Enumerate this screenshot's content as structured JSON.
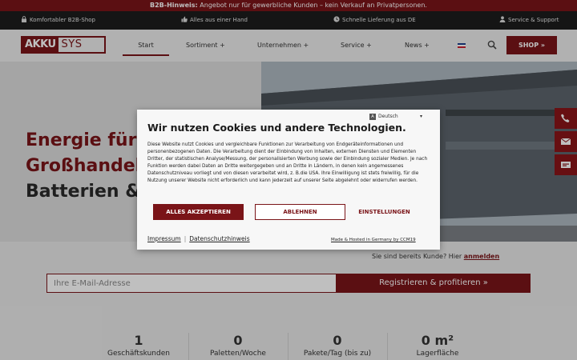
{
  "topbar": {
    "bold": "B2B-Hinweis:",
    "text": " Angebot nur für gewerbliche Kunden – kein Verkauf an Privatpersonen."
  },
  "infobar": {
    "items": [
      {
        "label": "Komfortabler B2B-Shop",
        "icon": "lock-icon"
      },
      {
        "label": "Alles aus einer Hand",
        "icon": "thumbs-up-icon"
      },
      {
        "label": "Schnelle Lieferung aus DE",
        "icon": "clock-icon"
      },
      {
        "label": "Service & Support",
        "icon": "user-icon"
      }
    ]
  },
  "logo": {
    "part1": "AKKU",
    "part2": "SYS"
  },
  "nav": {
    "items": [
      {
        "label": "Start"
      },
      {
        "label": "Sortiment  +"
      },
      {
        "label": "Unternehmen  +"
      },
      {
        "label": "Service  +"
      },
      {
        "label": "News  +"
      }
    ],
    "shop_label": "SHOP  »"
  },
  "hero": {
    "line1": "Energie für F",
    "line2": "Großhandel",
    "line3": "Batterien & A"
  },
  "login_prompt": {
    "text": "Sie sind bereits Kunde? Hier ",
    "link": "anmelden"
  },
  "register": {
    "placeholder": "Ihre E-Mail-Adresse",
    "button": "Registrieren & profitieren  »"
  },
  "stats": [
    {
      "value": "1",
      "label": "Geschäftskunden"
    },
    {
      "value": "0",
      "label": "Paletten/Woche"
    },
    {
      "value": "0",
      "label": "Pakete/Tag (bis zu)"
    },
    {
      "value": "0 m²",
      "label": "Lagerfläche"
    }
  ],
  "cookie": {
    "language": "Deutsch",
    "title": "Wir nutzen Cookies und andere Technologien.",
    "body": "Diese Website nutzt Cookies und vergleichbare Funktionen zur Verarbeitung von Endgeräteinformationen und personenbezogenen Daten. Die Verarbeitung dient der Einbindung von Inhalten, externen Diensten und Elementen Dritter, der statistischen Analyse/Messung, der personalisierten Werbung sowie der Einbindung sozialer Medien. Je nach Funktion werden dabei Daten an Dritte weitergegeben und an Dritte in Ländern, in denen kein angemessenes Datenschutzniveau vorliegt und von diesen verarbeitet wird, z. B.die USA. Ihre Einwilligung ist stets freiwillig, für die Nutzung unserer Website nicht erforderlich und kann jederzeit auf unserer Seite abgelehnt oder widerrufen werden.",
    "accept": "ALLES AKZEPTIEREN",
    "reject": "ABLEHNEN",
    "settings": "EINSTELLUNGEN",
    "impressum": "Impressum",
    "privacy": "Datenschutzhinweis",
    "hosted": "Made & Hosted in Germany by CCM19"
  },
  "colors": {
    "brand": "#7a1418",
    "dark": "#1c1c1c"
  }
}
